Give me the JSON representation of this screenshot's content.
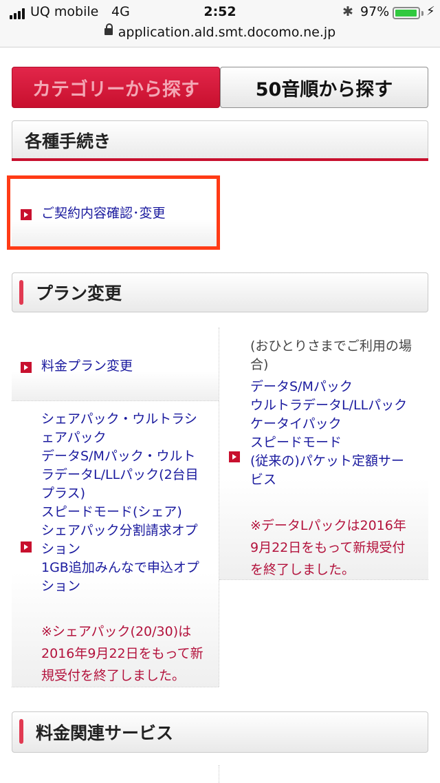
{
  "status_bar": {
    "carrier": "UQ mobile",
    "network": "4G",
    "time": "2:52",
    "battery_percent": "97%",
    "battery_level": 0.97,
    "battery_color": "#31c93f",
    "url": "application.ald.smt.docomo.ne.jp"
  },
  "tabs": {
    "category": "カテゴリーから探す",
    "syllabary": "50音順から探す"
  },
  "sections": {
    "procedures": {
      "title": "各種手続き",
      "item": "ご契約内容確認･変更"
    },
    "plan_change": {
      "title": "プラン変更",
      "left_item_1": "料金プラン変更",
      "left_item_2_lines": [
        "シェアパック・ウルトラシ",
        "ェアパック",
        "データS/Mパック・ウルト",
        "ラデータL/LLパック(2台目",
        "プラス)",
        "スピードモード(シェア)",
        "シェアパック分割請求オプ",
        "ション",
        "1GB追加みんなで申込オプ",
        "ション"
      ],
      "left_note_lines": [
        "※シェアパック(20/30)は",
        "2016年9月22日をもって新",
        "規受付を終了しました。"
      ],
      "right_intro_lines": [
        "(おひとりさまでご利用の場",
        "合)"
      ],
      "right_item_lines": [
        "データS/Mパック",
        "ウルトラデータL/LLパック",
        "ケータイパック",
        "スピードモード",
        "(従来の)パケット定額サー",
        "ビス"
      ],
      "right_note_lines": [
        "※データLパックは2016年",
        "9月22日をもって新規受付",
        "を終了しました。"
      ]
    },
    "fee_services": {
      "title": "料金関連サービス"
    }
  },
  "colors": {
    "brand_red": "#c8102e",
    "link_blue": "#1a1a9e",
    "note_red": "#b3123c",
    "highlight_orange": "#ff3b16"
  }
}
